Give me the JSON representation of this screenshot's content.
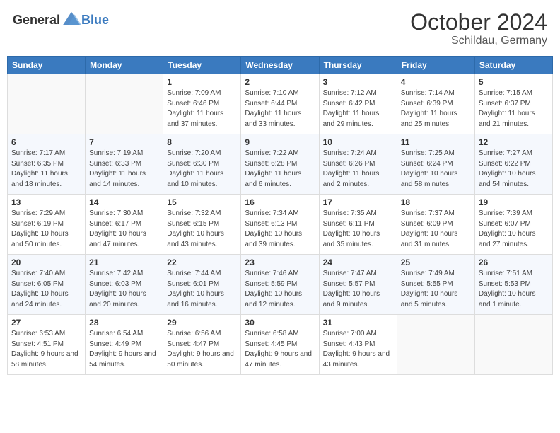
{
  "header": {
    "logo_general": "General",
    "logo_blue": "Blue",
    "month_title": "October 2024",
    "location": "Schildau, Germany"
  },
  "weekdays": [
    "Sunday",
    "Monday",
    "Tuesday",
    "Wednesday",
    "Thursday",
    "Friday",
    "Saturday"
  ],
  "weeks": [
    [
      {
        "day": "",
        "info": ""
      },
      {
        "day": "",
        "info": ""
      },
      {
        "day": "1",
        "info": "Sunrise: 7:09 AM\nSunset: 6:46 PM\nDaylight: 11 hours and 37 minutes."
      },
      {
        "day": "2",
        "info": "Sunrise: 7:10 AM\nSunset: 6:44 PM\nDaylight: 11 hours and 33 minutes."
      },
      {
        "day": "3",
        "info": "Sunrise: 7:12 AM\nSunset: 6:42 PM\nDaylight: 11 hours and 29 minutes."
      },
      {
        "day": "4",
        "info": "Sunrise: 7:14 AM\nSunset: 6:39 PM\nDaylight: 11 hours and 25 minutes."
      },
      {
        "day": "5",
        "info": "Sunrise: 7:15 AM\nSunset: 6:37 PM\nDaylight: 11 hours and 21 minutes."
      }
    ],
    [
      {
        "day": "6",
        "info": "Sunrise: 7:17 AM\nSunset: 6:35 PM\nDaylight: 11 hours and 18 minutes."
      },
      {
        "day": "7",
        "info": "Sunrise: 7:19 AM\nSunset: 6:33 PM\nDaylight: 11 hours and 14 minutes."
      },
      {
        "day": "8",
        "info": "Sunrise: 7:20 AM\nSunset: 6:30 PM\nDaylight: 11 hours and 10 minutes."
      },
      {
        "day": "9",
        "info": "Sunrise: 7:22 AM\nSunset: 6:28 PM\nDaylight: 11 hours and 6 minutes."
      },
      {
        "day": "10",
        "info": "Sunrise: 7:24 AM\nSunset: 6:26 PM\nDaylight: 11 hours and 2 minutes."
      },
      {
        "day": "11",
        "info": "Sunrise: 7:25 AM\nSunset: 6:24 PM\nDaylight: 10 hours and 58 minutes."
      },
      {
        "day": "12",
        "info": "Sunrise: 7:27 AM\nSunset: 6:22 PM\nDaylight: 10 hours and 54 minutes."
      }
    ],
    [
      {
        "day": "13",
        "info": "Sunrise: 7:29 AM\nSunset: 6:19 PM\nDaylight: 10 hours and 50 minutes."
      },
      {
        "day": "14",
        "info": "Sunrise: 7:30 AM\nSunset: 6:17 PM\nDaylight: 10 hours and 47 minutes."
      },
      {
        "day": "15",
        "info": "Sunrise: 7:32 AM\nSunset: 6:15 PM\nDaylight: 10 hours and 43 minutes."
      },
      {
        "day": "16",
        "info": "Sunrise: 7:34 AM\nSunset: 6:13 PM\nDaylight: 10 hours and 39 minutes."
      },
      {
        "day": "17",
        "info": "Sunrise: 7:35 AM\nSunset: 6:11 PM\nDaylight: 10 hours and 35 minutes."
      },
      {
        "day": "18",
        "info": "Sunrise: 7:37 AM\nSunset: 6:09 PM\nDaylight: 10 hours and 31 minutes."
      },
      {
        "day": "19",
        "info": "Sunrise: 7:39 AM\nSunset: 6:07 PM\nDaylight: 10 hours and 27 minutes."
      }
    ],
    [
      {
        "day": "20",
        "info": "Sunrise: 7:40 AM\nSunset: 6:05 PM\nDaylight: 10 hours and 24 minutes."
      },
      {
        "day": "21",
        "info": "Sunrise: 7:42 AM\nSunset: 6:03 PM\nDaylight: 10 hours and 20 minutes."
      },
      {
        "day": "22",
        "info": "Sunrise: 7:44 AM\nSunset: 6:01 PM\nDaylight: 10 hours and 16 minutes."
      },
      {
        "day": "23",
        "info": "Sunrise: 7:46 AM\nSunset: 5:59 PM\nDaylight: 10 hours and 12 minutes."
      },
      {
        "day": "24",
        "info": "Sunrise: 7:47 AM\nSunset: 5:57 PM\nDaylight: 10 hours and 9 minutes."
      },
      {
        "day": "25",
        "info": "Sunrise: 7:49 AM\nSunset: 5:55 PM\nDaylight: 10 hours and 5 minutes."
      },
      {
        "day": "26",
        "info": "Sunrise: 7:51 AM\nSunset: 5:53 PM\nDaylight: 10 hours and 1 minute."
      }
    ],
    [
      {
        "day": "27",
        "info": "Sunrise: 6:53 AM\nSunset: 4:51 PM\nDaylight: 9 hours and 58 minutes."
      },
      {
        "day": "28",
        "info": "Sunrise: 6:54 AM\nSunset: 4:49 PM\nDaylight: 9 hours and 54 minutes."
      },
      {
        "day": "29",
        "info": "Sunrise: 6:56 AM\nSunset: 4:47 PM\nDaylight: 9 hours and 50 minutes."
      },
      {
        "day": "30",
        "info": "Sunrise: 6:58 AM\nSunset: 4:45 PM\nDaylight: 9 hours and 47 minutes."
      },
      {
        "day": "31",
        "info": "Sunrise: 7:00 AM\nSunset: 4:43 PM\nDaylight: 9 hours and 43 minutes."
      },
      {
        "day": "",
        "info": ""
      },
      {
        "day": "",
        "info": ""
      }
    ]
  ]
}
